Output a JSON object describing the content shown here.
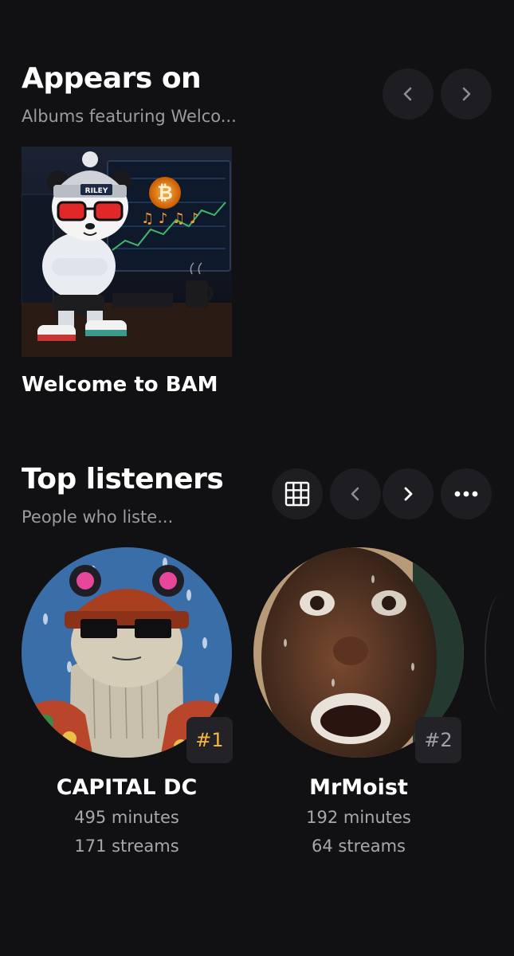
{
  "appears_on": {
    "title": "Appears on",
    "subtitle": "Albums featuring Welco...",
    "albums": [
      {
        "title": "Welcome to BAM",
        "art_text": "RILEY"
      }
    ]
  },
  "top_listeners": {
    "title": "Top listeners",
    "subtitle": "People who liste...",
    "listeners": [
      {
        "rank": "#1",
        "name": "CAPITAL DC",
        "minutes": "495 minutes",
        "streams": "171 streams",
        "rank_color": "#f4b840"
      },
      {
        "rank": "#2",
        "name": "MrMoist",
        "minutes": "192 minutes",
        "streams": "64 streams",
        "rank_color": "#a0a0a6"
      }
    ]
  },
  "colors": {
    "background": "#111113",
    "button_bg": "#1e1e22",
    "muted_text": "#9b9ba1",
    "rank1": "#f4b840"
  },
  "icons": [
    "chevron-left-icon",
    "chevron-right-icon",
    "grid-icon",
    "more-horizontal-icon"
  ]
}
